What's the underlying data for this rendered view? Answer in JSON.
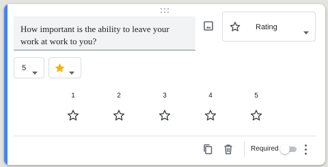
{
  "question": {
    "text": "How important is the ability to leave your work at work to you?"
  },
  "type_select": {
    "label": "Rating",
    "icon": "star-outline-icon"
  },
  "scale_select": {
    "value": "5"
  },
  "icon_select": {
    "icon": "star-filled-icon",
    "color": "#f4b400"
  },
  "rating": {
    "levels": [
      "1",
      "2",
      "3",
      "4",
      "5"
    ]
  },
  "footer": {
    "required_label": "Required",
    "required_on": false
  },
  "colors": {
    "accent": "#4285f4",
    "icon": "#5f6368",
    "star_outline": "#3c4043"
  }
}
